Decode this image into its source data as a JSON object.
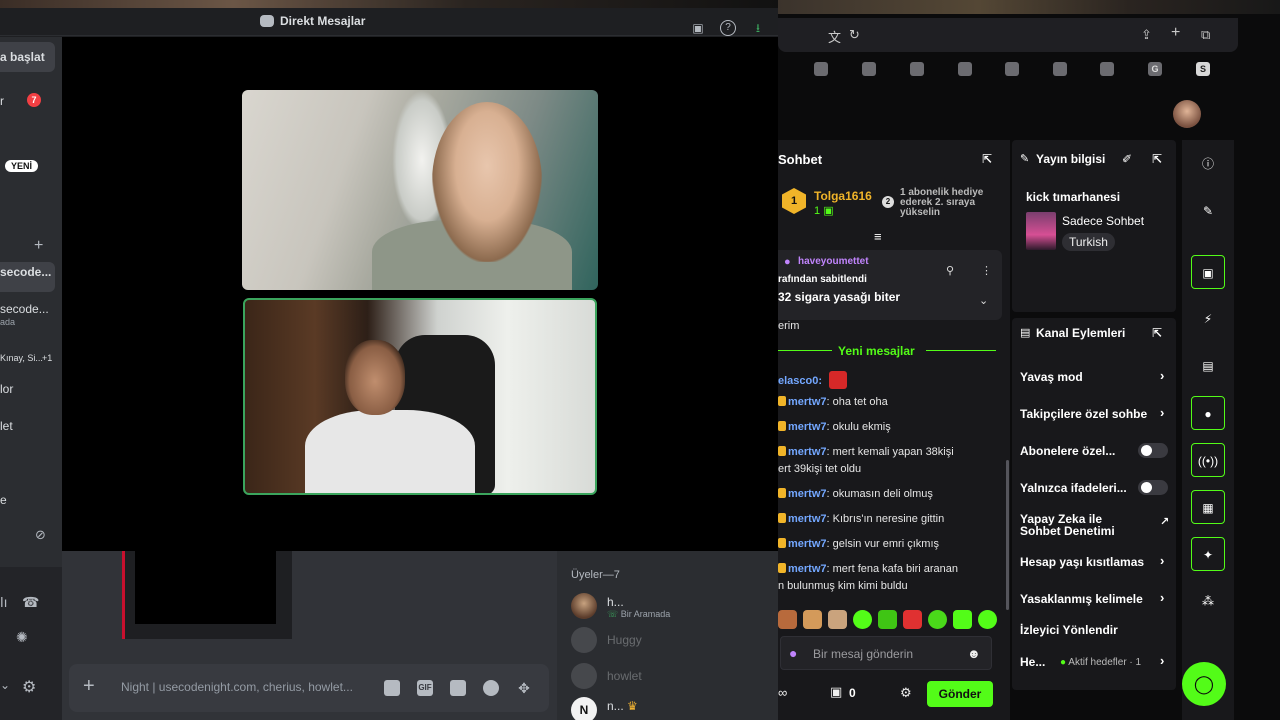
{
  "discord": {
    "window_title": "Direkt Mesajlar",
    "sidebar": {
      "start_label": "a başlat",
      "item_r_label": "r",
      "badge_count": "7",
      "new_badge": "YENİ",
      "dm1_label": "secode...",
      "dm2_label": "secode...",
      "dm2_sub": "ada",
      "dm3_label": "Kınay, Si...",
      "dm3_count": "+1",
      "item_lor": "lor",
      "item_let": "let",
      "item_e": "e"
    },
    "members": {
      "header": "Üyeler—7",
      "list": [
        {
          "name": "h...",
          "status": "Bir Aramada"
        },
        {
          "name": "Huggy",
          "status": ""
        },
        {
          "name": "howlet",
          "status": ""
        },
        {
          "name": "n...",
          "status": ""
        }
      ]
    },
    "composer": {
      "placeholder": "Night | usecodenight.com, cherius, howlet...",
      "gif_label": "GIF"
    }
  },
  "browser": {
    "bookmarks": [
      "G",
      "S"
    ]
  },
  "kick": {
    "chat": {
      "title": "Sohbet",
      "gift": {
        "user": "Tolga1616",
        "count": "1",
        "badge": "1",
        "rank": "2",
        "message": "1 abonelik hediye ederek 2. sıraya yükselin"
      },
      "pinned": {
        "user": "haveyoumettet",
        "by": "rafından sabitlendi",
        "message": "32 sigara yasağı biter"
      },
      "partial_line": "erim",
      "new_messages_label": "Yeni mesajlar",
      "first_user": "elasco0:",
      "messages": [
        {
          "user": "mertw7",
          "text": ": oha tet oha"
        },
        {
          "user": "mertw7",
          "text": ": okulu ekmiş"
        },
        {
          "user": "mertw7",
          "text": ": mert kemali yapan 38kişi"
        },
        {
          "user": "",
          "text": "ert 39kişi tet oldu"
        },
        {
          "user": "mertw7",
          "text": ": okumasın deli olmuş"
        },
        {
          "user": "mertw7",
          "text": ": Kıbrıs'ın neresine gittin"
        },
        {
          "user": "mertw7",
          "text": ": gelsin vur emri çıkmış"
        },
        {
          "user": "mertw7",
          "text": ": mert fena kafa biri aranan"
        },
        {
          "user": "",
          "text": "n bulunmuş kim kimi buldu"
        }
      ],
      "input_placeholder": "Bir mesaj gönderin",
      "points": "0",
      "send_label": "Gönder"
    },
    "stream_info": {
      "title": "Yayın bilgisi",
      "stream_title": "kick tımarhanesi",
      "category": "Sadece Sohbet",
      "language": "Turkish"
    },
    "channel_actions": {
      "title": "Kanal Eylemleri",
      "items": [
        {
          "label": "Yavaş mod",
          "type": "chevron"
        },
        {
          "label": "Takipçilere özel sohbe",
          "type": "chevron"
        },
        {
          "label": "Abonelere özel...",
          "type": "toggle"
        },
        {
          "label": "Yalnızca ifadeleri...",
          "type": "toggle"
        },
        {
          "label": "Yapay Zeka ile",
          "label2": "Sohbet Denetimi",
          "type": "link"
        },
        {
          "label": "Hesap yaşı kısıtlamas",
          "type": "chevron"
        },
        {
          "label": "Yasaklanmış kelimele",
          "type": "chevron"
        },
        {
          "label": "İzleyici Yönlendir",
          "type": "none"
        },
        {
          "label": "He...",
          "sub": "Aktif hedefler · 1",
          "type": "chevron"
        }
      ]
    }
  },
  "colors": {
    "kick_green": "#53fc18",
    "discord_bg": "#1e1f22",
    "accent_red": "#f23f43"
  }
}
